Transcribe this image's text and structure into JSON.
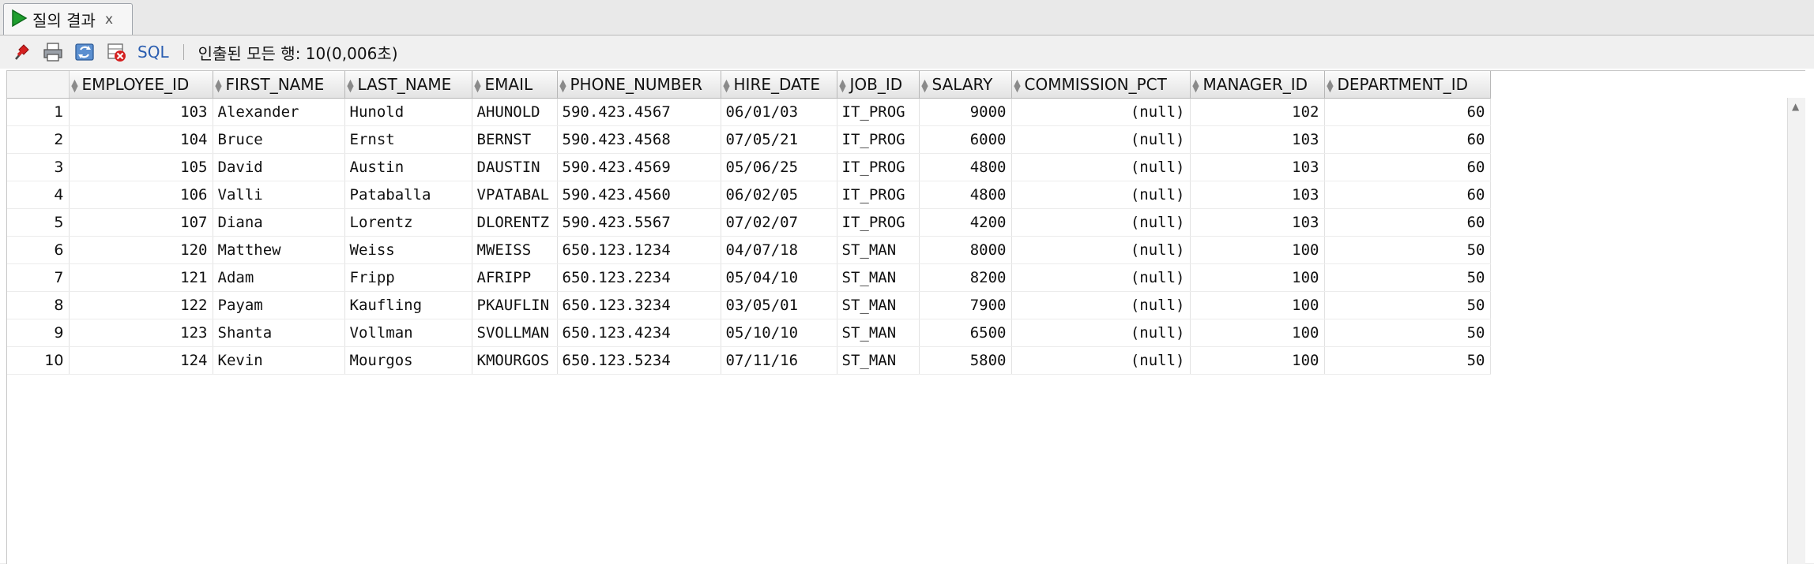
{
  "tab": {
    "label": "질의 결과",
    "close": "x"
  },
  "toolbar": {
    "sql_label": "SQL",
    "status": "인출된 모든 행: 10(0,006초)"
  },
  "grid": {
    "columns": [
      "EMPLOYEE_ID",
      "FIRST_NAME",
      "LAST_NAME",
      "EMAIL",
      "PHONE_NUMBER",
      "HIRE_DATE",
      "JOB_ID",
      "SALARY",
      "COMMISSION_PCT",
      "MANAGER_ID",
      "DEPARTMENT_ID"
    ],
    "rows": [
      [
        "1",
        "103",
        "Alexander",
        "Hunold",
        "AHUNOLD",
        "590.423.4567",
        "06/01/03",
        "IT_PROG",
        "9000",
        "(null)",
        "102",
        "60"
      ],
      [
        "2",
        "104",
        "Bruce",
        "Ernst",
        "BERNST",
        "590.423.4568",
        "07/05/21",
        "IT_PROG",
        "6000",
        "(null)",
        "103",
        "60"
      ],
      [
        "3",
        "105",
        "David",
        "Austin",
        "DAUSTIN",
        "590.423.4569",
        "05/06/25",
        "IT_PROG",
        "4800",
        "(null)",
        "103",
        "60"
      ],
      [
        "4",
        "106",
        "Valli",
        "Pataballa",
        "VPATABAL",
        "590.423.4560",
        "06/02/05",
        "IT_PROG",
        "4800",
        "(null)",
        "103",
        "60"
      ],
      [
        "5",
        "107",
        "Diana",
        "Lorentz",
        "DLORENTZ",
        "590.423.5567",
        "07/02/07",
        "IT_PROG",
        "4200",
        "(null)",
        "103",
        "60"
      ],
      [
        "6",
        "120",
        "Matthew",
        "Weiss",
        "MWEISS",
        "650.123.1234",
        "04/07/18",
        "ST_MAN",
        "8000",
        "(null)",
        "100",
        "50"
      ],
      [
        "7",
        "121",
        "Adam",
        "Fripp",
        "AFRIPP",
        "650.123.2234",
        "05/04/10",
        "ST_MAN",
        "8200",
        "(null)",
        "100",
        "50"
      ],
      [
        "8",
        "122",
        "Payam",
        "Kaufling",
        "PKAUFLIN",
        "650.123.3234",
        "03/05/01",
        "ST_MAN",
        "7900",
        "(null)",
        "100",
        "50"
      ],
      [
        "9",
        "123",
        "Shanta",
        "Vollman",
        "SVOLLMAN",
        "650.123.4234",
        "05/10/10",
        "ST_MAN",
        "6500",
        "(null)",
        "100",
        "50"
      ],
      [
        "10",
        "124",
        "Kevin",
        "Mourgos",
        "KMOURGOS",
        "650.123.5234",
        "07/11/16",
        "ST_MAN",
        "5800",
        "(null)",
        "100",
        "50"
      ]
    ]
  },
  "icons": {
    "run": "play-icon",
    "pin": "pin-icon",
    "print": "print-icon",
    "refresh": "refresh-icon",
    "delete": "delete-icon"
  },
  "colors": {
    "run_green": "#1e9e2e",
    "sql_blue": "#2a5db0",
    "pin_red": "#d42020"
  }
}
